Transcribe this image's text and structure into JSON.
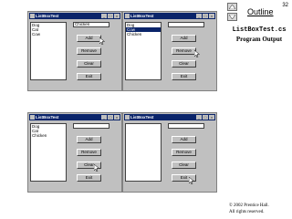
{
  "page_number": "32",
  "nav": {
    "up_icon": "triangle-up-icon",
    "down_icon": "triangle-down-icon"
  },
  "outline_label": "Outline",
  "program_title": "ListBoxTest.cs",
  "program_subtitle": "Program Output",
  "copyright": [
    "© 2002 Prentice Hall.",
    "All rights reserved."
  ],
  "buttons": {
    "add": "Add",
    "remove": "Remove",
    "clear": "Clear",
    "exit": "Exit"
  },
  "window_controls": {
    "minimize": "_",
    "maximize": "□",
    "close": "×"
  },
  "windows": [
    {
      "title": "ListBoxTest",
      "items": [
        "Dog",
        "Cat",
        "Cow"
      ],
      "selected": null,
      "textbox": "Chicken"
    },
    {
      "title": "ListBoxTest",
      "items": [
        "Dog",
        "Cow",
        "Chicken"
      ],
      "selected": 1,
      "textbox": ""
    },
    {
      "title": "ListBoxTest",
      "items": [
        "Dog",
        "Cat",
        "Chicken"
      ],
      "selected": null,
      "textbox": ""
    },
    {
      "title": "ListBoxTest",
      "items": [],
      "selected": null,
      "textbox": ""
    }
  ],
  "colors": {
    "titlebar": "#0a246a",
    "window_face": "#c0c0c0",
    "selection": "#0a246a"
  }
}
